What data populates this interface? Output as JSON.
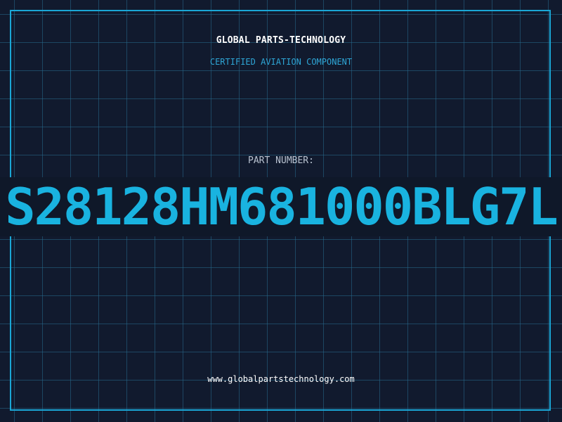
{
  "header": {
    "brand": "GLOBAL PARTS-TECHNOLOGY",
    "subtitle": "CERTIFIED AVIATION COMPONENT"
  },
  "part": {
    "label": "PART NUMBER:",
    "number": "S28128HM681000BLG7L"
  },
  "footer": {
    "url": "www.globalpartstechnology.com"
  },
  "colors": {
    "background": "#111a2e",
    "grid": "#26698c",
    "frame": "#1aa7d6",
    "accent": "#19b3e0",
    "brand_text": "#ffffff",
    "label_text": "#b9c3d1"
  }
}
